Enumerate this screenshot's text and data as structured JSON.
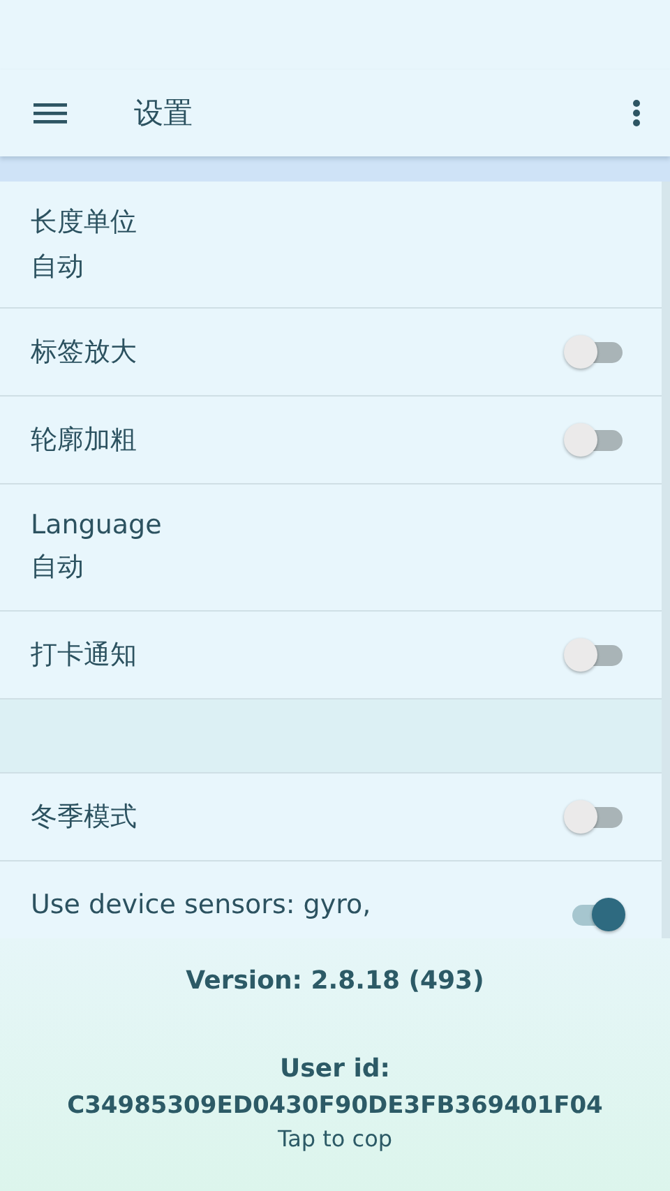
{
  "toolbar": {
    "title": "设置"
  },
  "sections": [
    {
      "items": [
        {
          "kind": "value",
          "title": "长度单位",
          "value": "自动"
        },
        {
          "kind": "switch",
          "title": "标签放大",
          "on": false
        },
        {
          "kind": "switch",
          "title": "轮廓加粗",
          "on": false
        },
        {
          "kind": "value",
          "title": "Language",
          "value": "自动"
        },
        {
          "kind": "switch",
          "title": "打卡通知",
          "on": false
        }
      ]
    },
    {
      "items": [
        {
          "kind": "switch",
          "title": "冬季模式",
          "on": false
        },
        {
          "kind": "switch",
          "title": "Use device sensors: gyro,",
          "on": true
        }
      ]
    }
  ],
  "footer": {
    "version": "Version: 2.8.18 (493)",
    "user_id_label": "User id:",
    "user_id": "C34985309ED0430F90DE3FB369401F04",
    "hint": "Tap to cop"
  }
}
